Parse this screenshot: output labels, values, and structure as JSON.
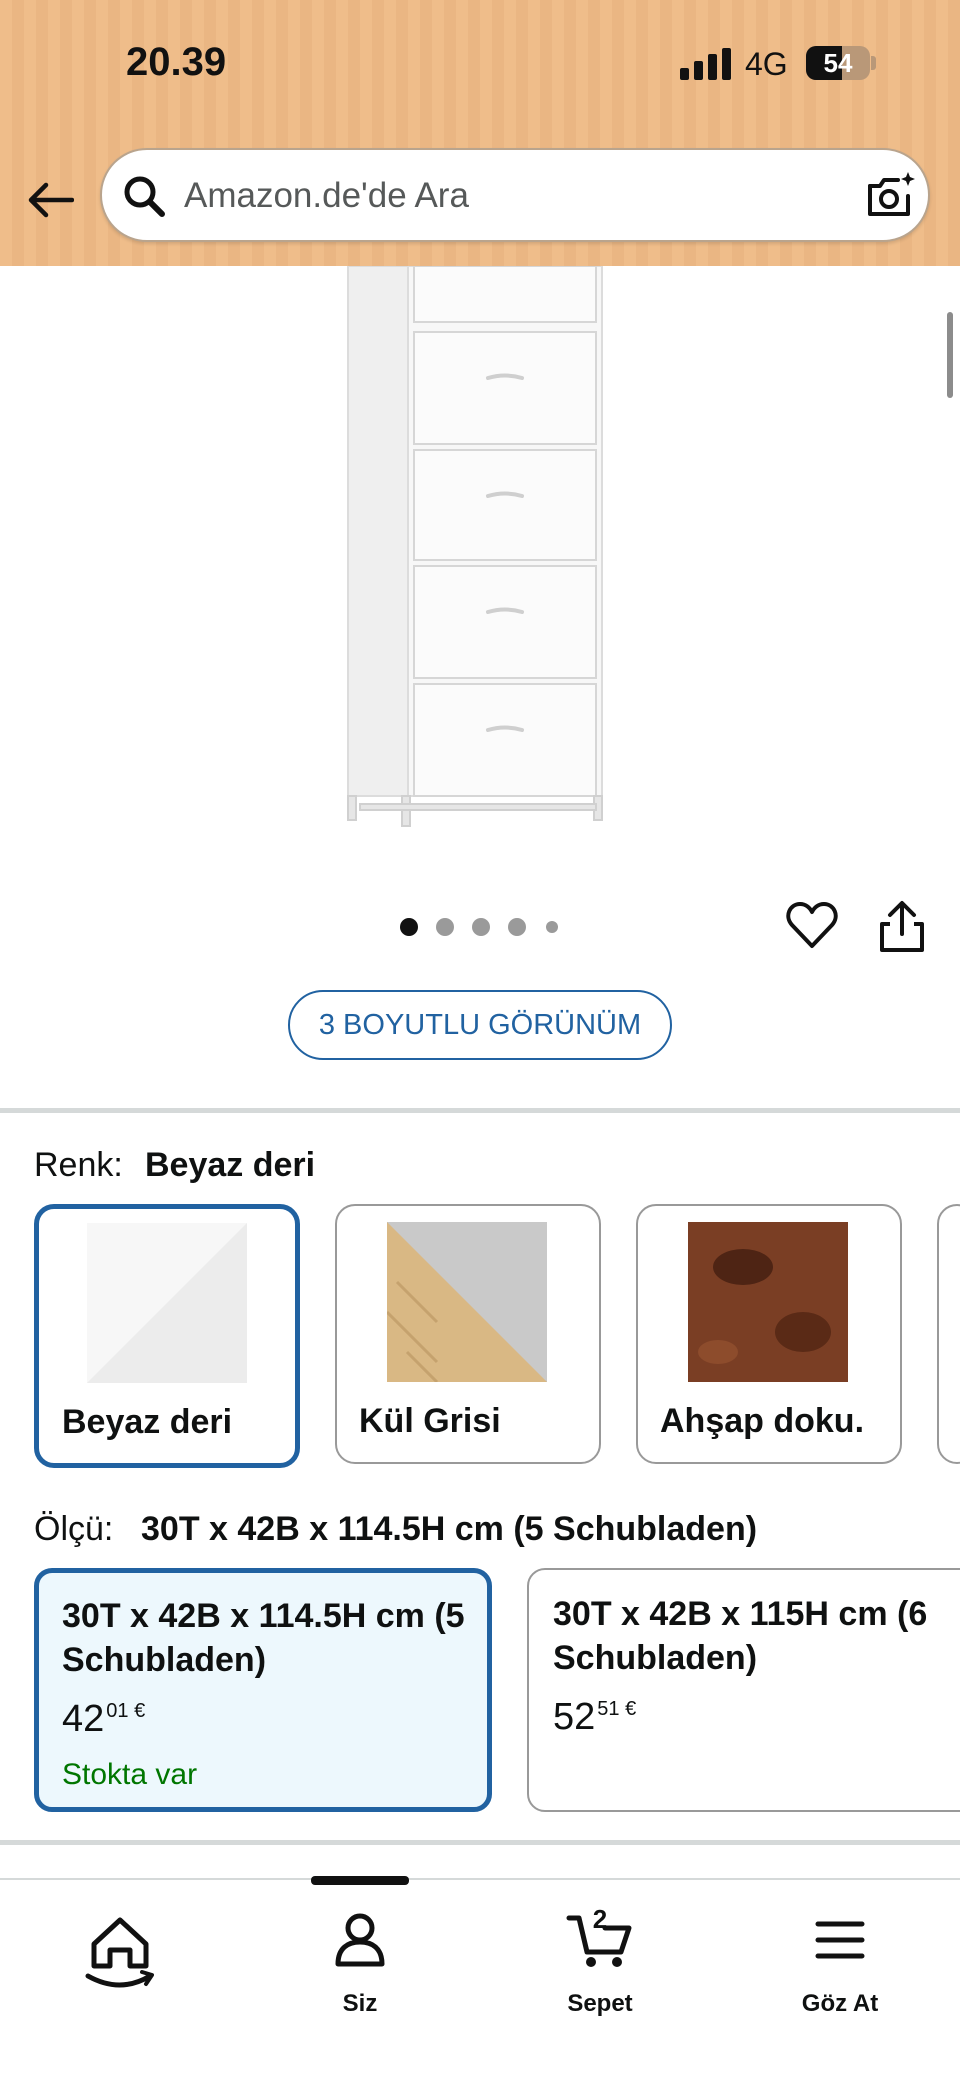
{
  "status_bar": {
    "time": "20.39",
    "network": "4G",
    "battery": "54"
  },
  "search": {
    "placeholder": "Amazon.de'de Ara"
  },
  "gallery": {
    "image_count": 5,
    "active_index": 0,
    "view_3d_label": "3 BOYUTLU GÖRÜNÜM"
  },
  "color_section": {
    "label": "Renk:",
    "selected": "Beyaz deri",
    "options": [
      {
        "name": "Beyaz deri",
        "selected": true
      },
      {
        "name": "Kül Grisi",
        "selected": false
      },
      {
        "name": "Ahşap doku.",
        "selected": false
      }
    ]
  },
  "size_section": {
    "label": "Ölçü:",
    "selected": "30T x 42B x 114.5H cm (5 Schubladen)",
    "options": [
      {
        "title": "30T x 42B x 114.5H cm (5 Schubladen)",
        "price_whole": "42",
        "price_fraction": "01 €",
        "stock": "Stokta var",
        "selected": true
      },
      {
        "title": "30T x 42B x 115H cm (6 Schubladen)",
        "price_whole": "52",
        "price_fraction": "51 €",
        "stock": "",
        "selected": false
      }
    ]
  },
  "bottom_nav": {
    "items": [
      {
        "label": ""
      },
      {
        "label": "Siz"
      },
      {
        "label": "Sepet",
        "count": "2"
      },
      {
        "label": "Göz At"
      }
    ]
  },
  "colors": {
    "accent": "#2162a1",
    "header": "#efbd8a",
    "in_stock": "#007600"
  }
}
